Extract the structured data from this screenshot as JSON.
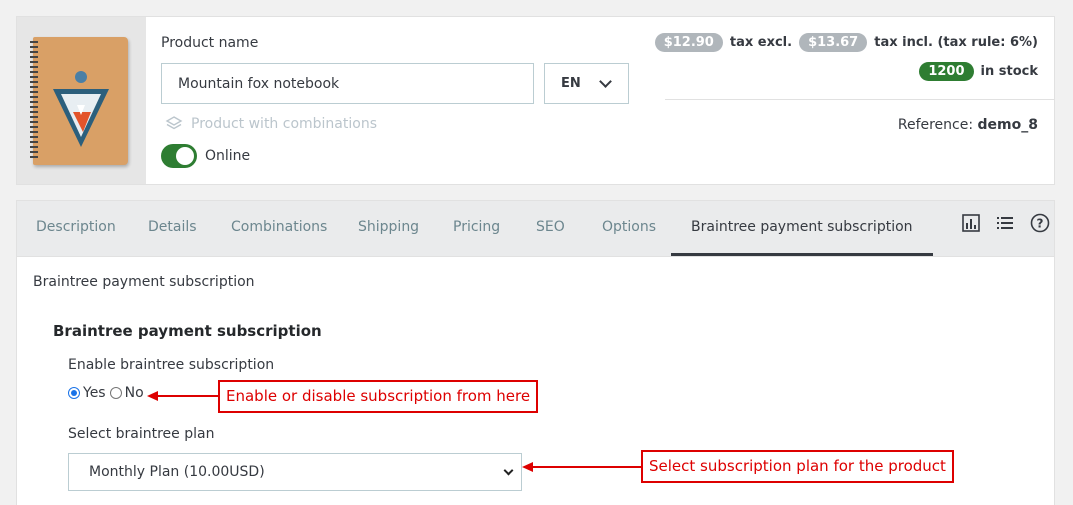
{
  "product": {
    "name_label": "Product name",
    "name_value": "Mountain fox notebook",
    "language": "EN",
    "combinations_label": "Product with combinations",
    "online_label": "Online",
    "online": true
  },
  "pricing": {
    "price_excl": "$12.90",
    "excl_label": "tax excl.",
    "price_incl": "$13.67",
    "incl_label": "tax incl. (tax rule: 6%)",
    "stock_qty": "1200",
    "stock_label": "in stock",
    "reference_label": "Reference:",
    "reference_value": "demo_8"
  },
  "tabs": [
    {
      "label": "Description"
    },
    {
      "label": "Details"
    },
    {
      "label": "Combinations"
    },
    {
      "label": "Shipping"
    },
    {
      "label": "Pricing"
    },
    {
      "label": "SEO"
    },
    {
      "label": "Options"
    },
    {
      "label": "Braintree payment subscription",
      "active": true
    }
  ],
  "toolbar_icons": [
    "stats-icon",
    "list-icon",
    "help-icon"
  ],
  "panel": {
    "breadcrumb": "Braintree payment subscription",
    "section_title": "Braintree payment subscription",
    "enable_label": "Enable braintree subscription",
    "yes_label": "Yes",
    "no_label": "No",
    "selected_option": "Yes",
    "plan_label": "Select braintree plan",
    "plan_value": "Monthly Plan (10.00USD)"
  },
  "annotations": {
    "enable_note": "Enable or disable subscription from here",
    "plan_note": "Select subscription plan for the product"
  },
  "colors": {
    "online_toggle": "#2e7d32",
    "stock_badge": "#2e7d32",
    "price_badge": "#b0b6bb",
    "annotation": "#dd0000"
  }
}
